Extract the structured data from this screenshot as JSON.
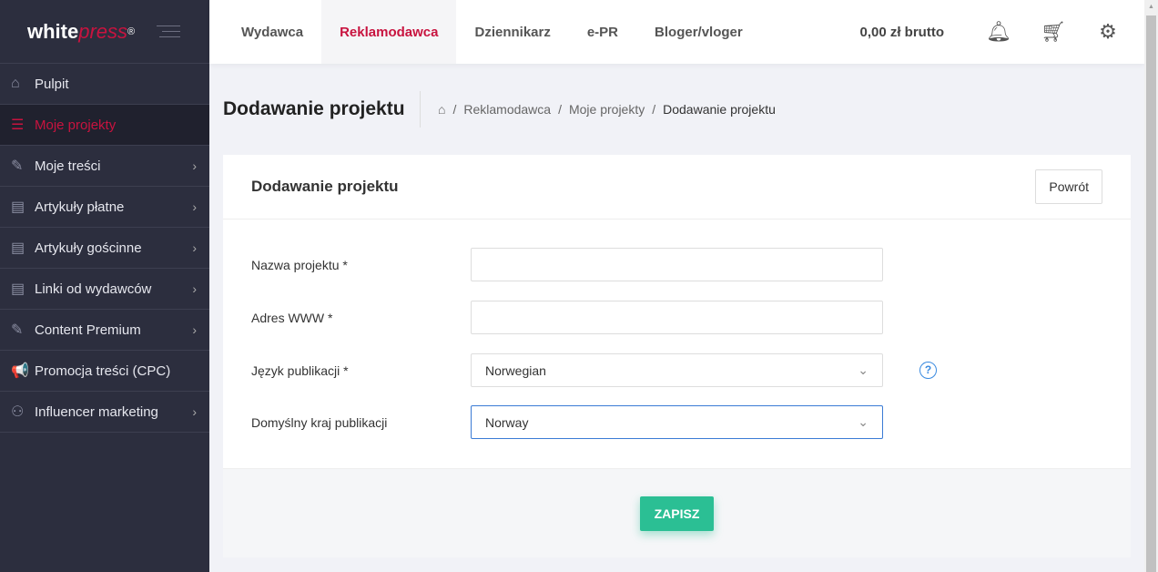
{
  "logo": {
    "white": "white",
    "press": "press",
    "reg": "®"
  },
  "sidebar": {
    "items": [
      {
        "label": "Pulpit",
        "icon": "home-icon",
        "glyph": "⌂",
        "chevron": false
      },
      {
        "label": "Moje projekty",
        "icon": "list-icon",
        "glyph": "☰",
        "chevron": false,
        "active": true
      },
      {
        "label": "Moje treści",
        "icon": "edit-icon",
        "glyph": "✎",
        "chevron": true
      },
      {
        "label": "Artykuły płatne",
        "icon": "document-icon",
        "glyph": "▤",
        "chevron": true
      },
      {
        "label": "Artykuły gościnne",
        "icon": "document-icon",
        "glyph": "▤",
        "chevron": true
      },
      {
        "label": "Linki od wydawców",
        "icon": "document-icon",
        "glyph": "▤",
        "chevron": true
      },
      {
        "label": "Content Premium",
        "icon": "edit-icon",
        "glyph": "✎",
        "chevron": true
      },
      {
        "label": "Promocja treści (CPC)",
        "icon": "megaphone-icon",
        "glyph": "📢",
        "chevron": false
      },
      {
        "label": "Influencer marketing",
        "icon": "users-icon",
        "glyph": "⚇",
        "chevron": true
      }
    ]
  },
  "topbar": {
    "tabs": [
      "Wydawca",
      "Reklamodawca",
      "Dziennikarz",
      "e-PR",
      "Bloger/vloger"
    ],
    "active_tab": "Reklamodawca",
    "balance": "0,00 zł brutto"
  },
  "page": {
    "title": "Dodawanie projektu",
    "breadcrumb": [
      "Reklamodawca",
      "Moje projekty",
      "Dodawanie projektu"
    ]
  },
  "card": {
    "title": "Dodawanie projektu",
    "back": "Powrót",
    "save": "ZAPISZ",
    "fields": [
      {
        "label": "Nazwa projektu *",
        "value": ""
      },
      {
        "label": "Adres WWW *",
        "value": ""
      },
      {
        "label": "Język publikacji *",
        "value": "Norwegian"
      },
      {
        "label": "Domyślny kraj publikacji",
        "value": "Norway"
      }
    ]
  },
  "colors": {
    "accent": "#c8133f",
    "save": "#2bbf94",
    "sidebar": "#2c2e3e"
  }
}
